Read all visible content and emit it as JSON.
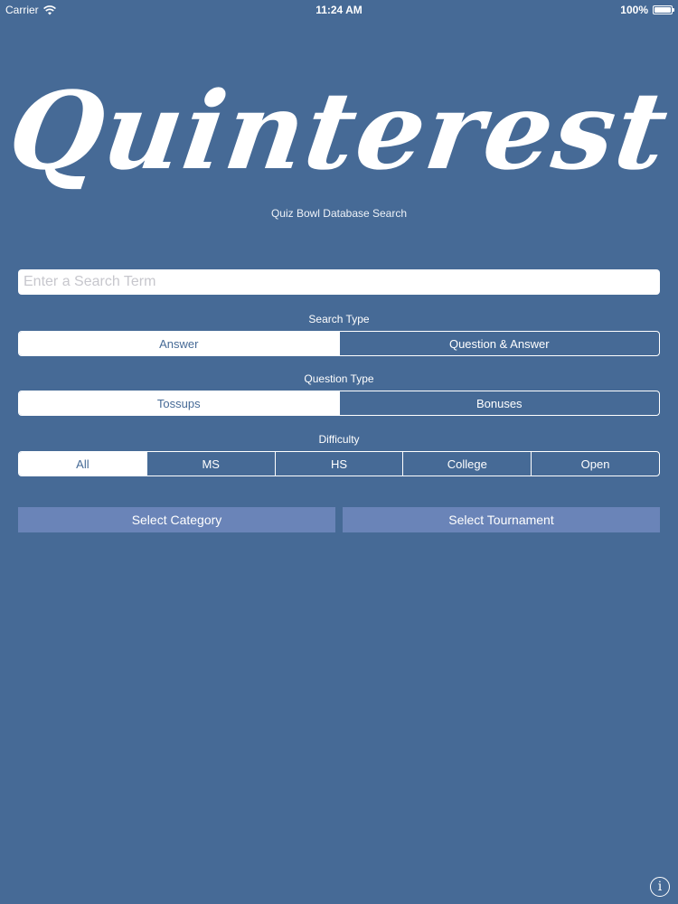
{
  "status_bar": {
    "carrier": "Carrier",
    "time": "11:24 AM",
    "battery": "100%",
    "battery_level": 1.0,
    "wifi_icon": "wifi-icon",
    "battery_icon": "battery-icon"
  },
  "logo": {
    "text": "Quinterest"
  },
  "subtitle": "Quiz Bowl Database Search",
  "search": {
    "placeholder": "Enter a Search Term",
    "value": ""
  },
  "search_type": {
    "label": "Search Type",
    "options": [
      "Answer",
      "Question & Answer"
    ],
    "selected": "Answer"
  },
  "question_type": {
    "label": "Question Type",
    "options": [
      "Tossups",
      "Bonuses"
    ],
    "selected": "Tossups"
  },
  "difficulty": {
    "label": "Difficulty",
    "options": [
      "All",
      "MS",
      "HS",
      "College",
      "Open"
    ],
    "selected": "All"
  },
  "buttons": {
    "select_category": "Select Category",
    "select_tournament": "Select Tournament"
  },
  "info": {
    "glyph": "i",
    "icon": "info-icon"
  },
  "colors": {
    "background": "#466a96",
    "button": "#6a84b8",
    "foreground": "#ffffff"
  }
}
